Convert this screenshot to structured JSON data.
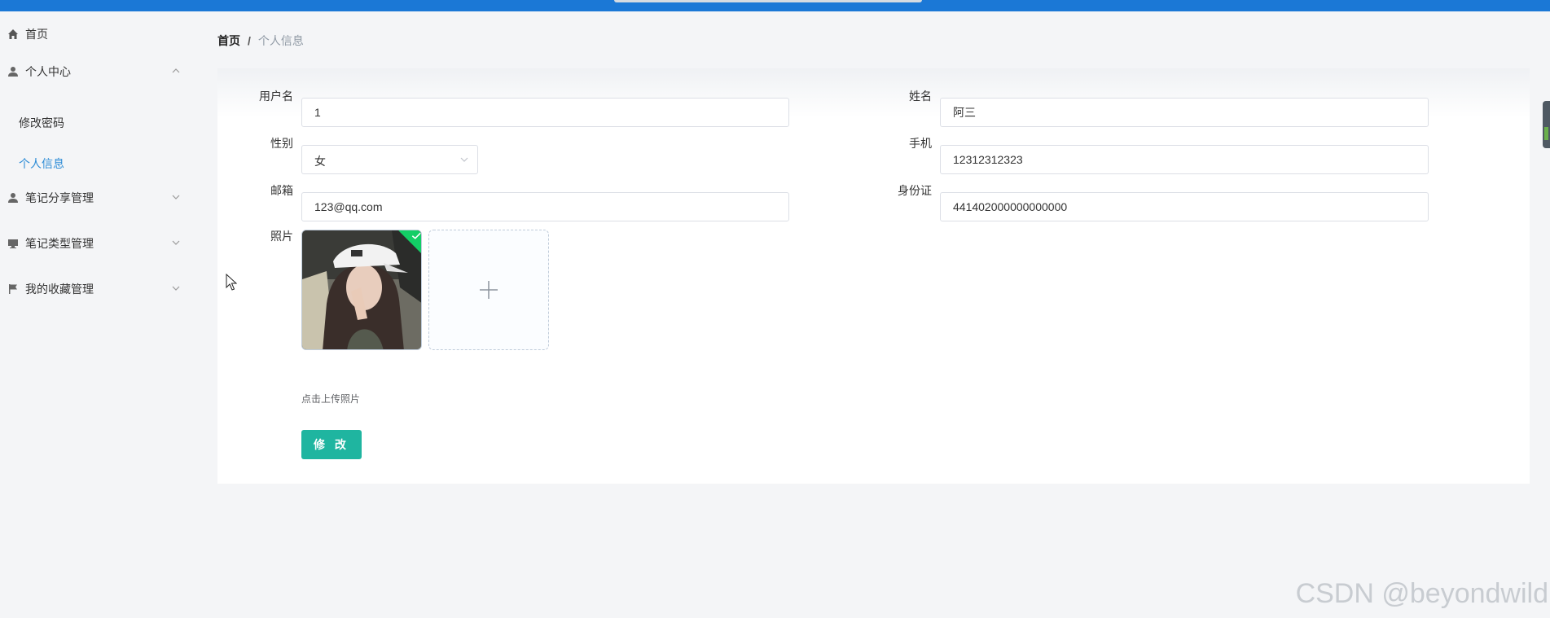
{
  "sidebar": {
    "items": [
      {
        "label": "首页",
        "icon": "home-icon"
      },
      {
        "label": "个人中心",
        "icon": "user-icon",
        "expanded": true,
        "children": [
          {
            "label": "修改密码",
            "active": false
          },
          {
            "label": "个人信息",
            "active": true
          }
        ]
      },
      {
        "label": "笔记分享管理",
        "icon": "user-icon",
        "expanded": false
      },
      {
        "label": "笔记类型管理",
        "icon": "monitor-icon",
        "expanded": false
      },
      {
        "label": "我的收藏管理",
        "icon": "flag-icon",
        "expanded": false
      }
    ]
  },
  "breadcrumb": {
    "home": "首页",
    "separator": "/",
    "current": "个人信息"
  },
  "form": {
    "username": {
      "label": "用户名",
      "value": "1"
    },
    "name": {
      "label": "姓名",
      "value": "阿三"
    },
    "gender": {
      "label": "性别",
      "value": "女"
    },
    "phone": {
      "label": "手机",
      "value": "12312312323"
    },
    "email": {
      "label": "邮箱",
      "value": "123@qq.com"
    },
    "id_card": {
      "label": "身份证",
      "value": "441402000000000000"
    },
    "photo": {
      "label": "照片",
      "tip": "点击上传照片"
    },
    "submit_label": "修 改"
  },
  "watermark": "CSDN @beyondwild",
  "colors": {
    "topbar": "#1b78d6",
    "active_menu": "#2d8cd6",
    "submit_button": "#1fb5a0",
    "upload_success": "#13ce66"
  }
}
